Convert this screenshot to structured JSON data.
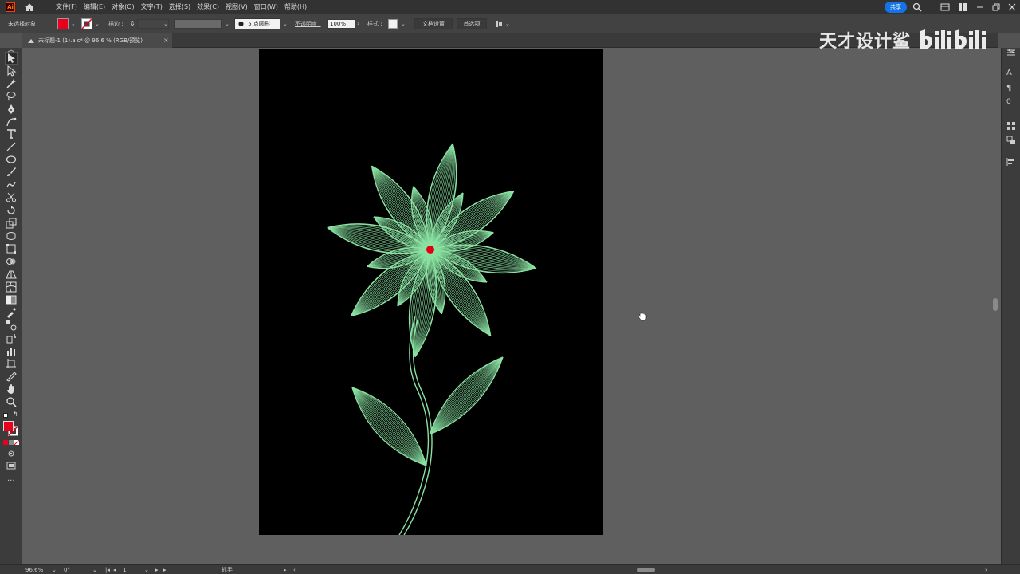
{
  "menubar": {
    "app_icon": "Ai",
    "items": [
      "文件(F)",
      "编辑(E)",
      "对象(O)",
      "文字(T)",
      "选择(S)",
      "效果(C)",
      "视图(V)",
      "窗口(W)",
      "帮助(H)"
    ],
    "share_label": "共享"
  },
  "controlbar": {
    "selection_status": "未选择对象",
    "fill_color": "#e8001c",
    "stroke_label": "描边 :",
    "point_shape": "5 点圆形",
    "opacity_label": "不透明度 :",
    "opacity_value": "100%",
    "style_label": "样式 :",
    "doc_setup_label": "文档设置",
    "preferences_label": "首选项"
  },
  "document_tab": {
    "label": "未标题-1 (1).aic* @ 96.6 % (RGB/预览)",
    "close": "×"
  },
  "statusbar": {
    "zoom": "96.6%",
    "rotation": "0°",
    "artboard_index": "1",
    "tool_name": "抓手"
  },
  "watermark": {
    "text": "天才设计鲨",
    "logo": "bilibili"
  },
  "colors": {
    "flower_line": "#8be3a3",
    "flower_center": "#e00012",
    "artboard_bg": "#000000",
    "canvas_bg": "#5f5f5f",
    "accent": "#1473e6"
  },
  "icons": [
    "selection-tool-icon",
    "direct-selection-icon",
    "magic-wand-icon",
    "lasso-icon",
    "pen-icon",
    "curvature-icon",
    "type-icon",
    "line-icon",
    "ellipse-icon",
    "paintbrush-icon",
    "shaper-icon",
    "scissors-icon",
    "rotate-icon",
    "scale-icon",
    "warp-icon",
    "free-transform-icon",
    "shape-builder-icon",
    "perspective-icon",
    "mesh-icon",
    "gradient-icon",
    "eyedropper-icon",
    "blend-icon",
    "symbol-sprayer-icon",
    "column-graph-icon",
    "artboard-icon",
    "slice-icon",
    "hand-icon",
    "zoom-icon"
  ]
}
